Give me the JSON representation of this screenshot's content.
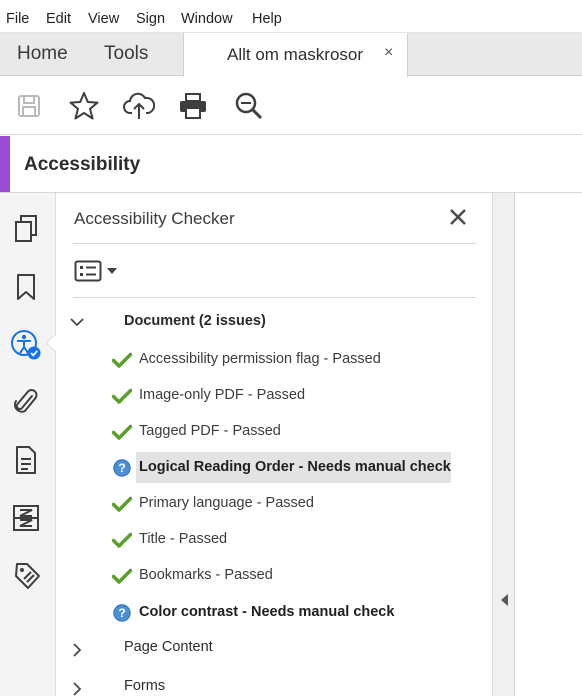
{
  "menubar": {
    "items": [
      "File",
      "Edit",
      "View",
      "Sign",
      "Window",
      "Help"
    ]
  },
  "tabs": {
    "home": "Home",
    "tools": "Tools",
    "document": "Allt om maskrosor",
    "close_glyph": "×"
  },
  "toolbar": {
    "buttons": [
      "save-icon",
      "star-icon",
      "upload-cloud-icon",
      "print-icon",
      "zoom-search-icon"
    ]
  },
  "panel_header": {
    "title": "Accessibility",
    "accent_color": "#9a4bd1"
  },
  "left_rail": {
    "icons": [
      "pages-icon",
      "bookmark-icon",
      "accessibility-check-icon",
      "attachment-icon",
      "document-properties-icon",
      "content-order-icon",
      "tags-icon"
    ],
    "active": "accessibility-check-icon"
  },
  "checker": {
    "title": "Accessibility Checker",
    "document_section": "Document (2 issues)",
    "items": [
      {
        "label": "Accessibility permission flag - Passed",
        "status": "passed"
      },
      {
        "label": "Image-only PDF - Passed",
        "status": "passed"
      },
      {
        "label": "Tagged PDF - Passed",
        "status": "passed"
      },
      {
        "label": "Logical Reading Order - Needs manual check",
        "status": "manual"
      },
      {
        "label": "Primary language - Passed",
        "status": "passed"
      },
      {
        "label": "Title - Passed",
        "status": "passed"
      },
      {
        "label": "Bookmarks - Passed",
        "status": "passed"
      },
      {
        "label": "Color contrast - Needs manual check",
        "status": "manual"
      }
    ],
    "collapsed_sections": [
      "Page Content",
      "Forms"
    ]
  },
  "colors": {
    "passed": "#5aa02c",
    "manual": "#4a90d9",
    "accent": "#9a4bd1"
  }
}
